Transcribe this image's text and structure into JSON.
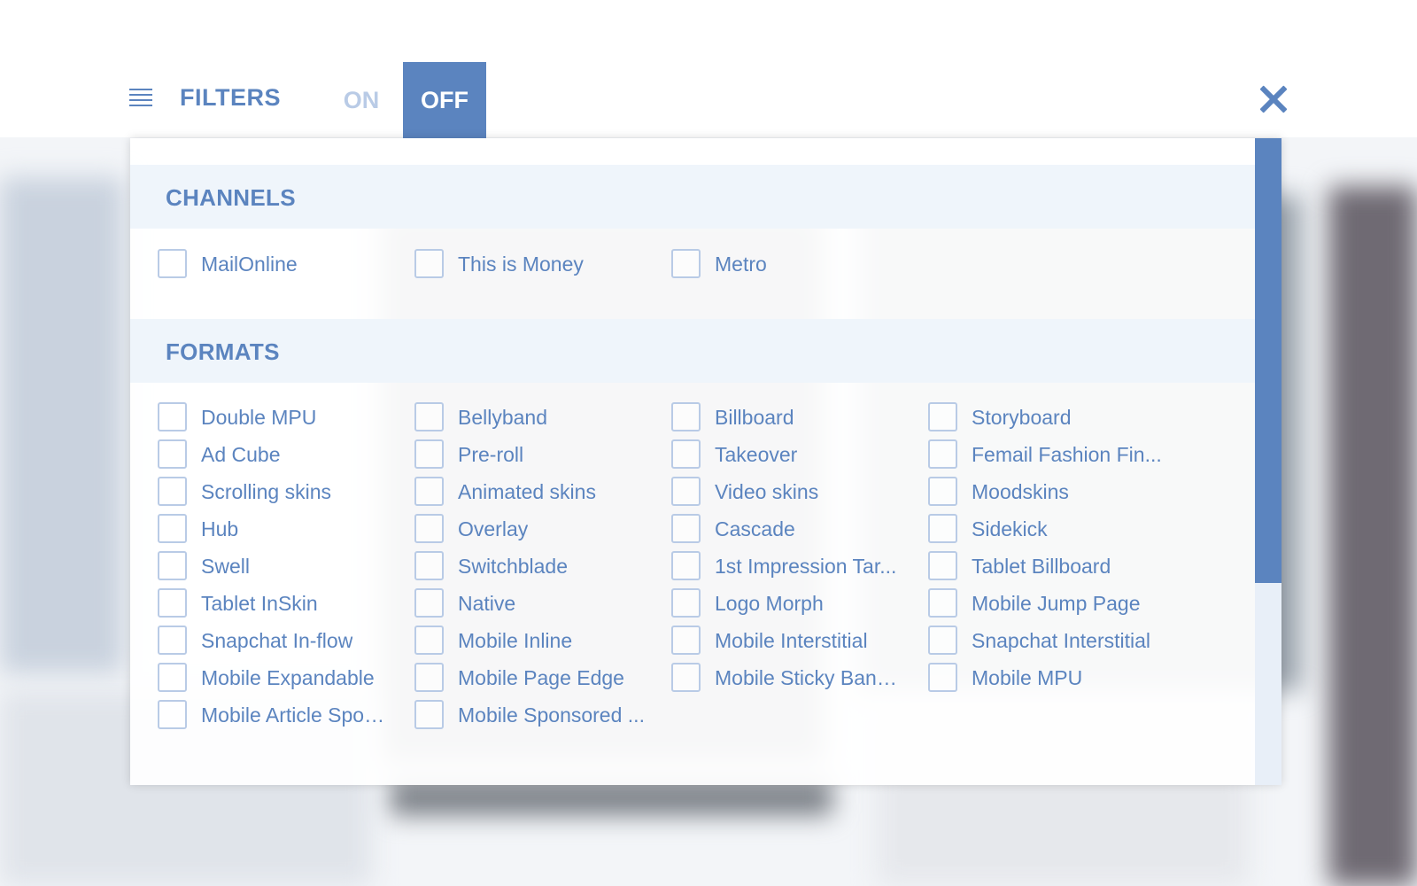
{
  "header": {
    "title": "FILTERS",
    "toggle_on": "ON",
    "toggle_off": "OFF",
    "active_toggle": "OFF"
  },
  "colors": {
    "accent": "#5b84bf",
    "muted": "#b9cbe6"
  },
  "icons": {
    "menu": "menu-lines-icon",
    "close": "close-icon"
  },
  "channels": {
    "heading": "CHANNELS",
    "items": [
      "MailOnline",
      "This is Money",
      "Metro"
    ]
  },
  "formats": {
    "heading": "FORMATS",
    "items": [
      "Double MPU",
      "Bellyband",
      "Billboard",
      "Storyboard",
      "Ad Cube",
      "Pre-roll",
      "Takeover",
      "Femail Fashion Fin...",
      "Scrolling skins",
      "Animated skins",
      "Video skins",
      "Moodskins",
      "Hub",
      "Overlay",
      "Cascade",
      "Sidekick",
      "Swell",
      "Switchblade",
      "1st Impression Tar...",
      "Tablet Billboard",
      "Tablet InSkin",
      "Native",
      "Logo Morph",
      "Mobile Jump Page",
      "Snapchat In-flow",
      "Mobile Inline",
      "Mobile Interstitial",
      "Snapchat Interstitial",
      "Mobile Expandable",
      "Mobile Page Edge",
      "Mobile Sticky Banner",
      "Mobile MPU",
      "Mobile Article Spon...",
      "Mobile Sponsored ..."
    ]
  }
}
